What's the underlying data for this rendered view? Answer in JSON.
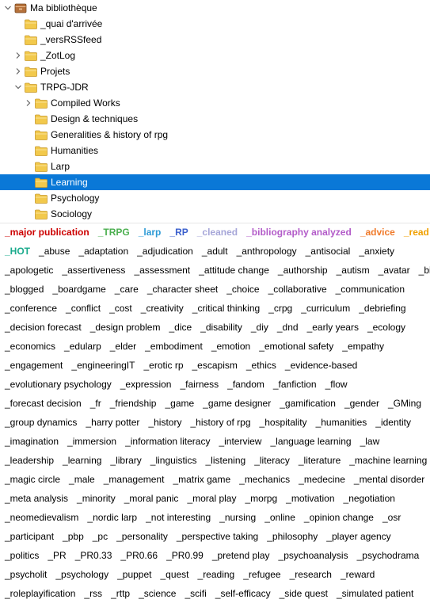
{
  "tree": {
    "root": {
      "label": "Ma bibliothèque",
      "expanded": true
    },
    "items": [
      {
        "label": "_quai d'arrivée",
        "depth": 1,
        "twisty": "none"
      },
      {
        "label": "_versRSSfeed",
        "depth": 1,
        "twisty": "none"
      },
      {
        "label": "_ZotLog",
        "depth": 1,
        "twisty": "collapsed"
      },
      {
        "label": "Projets",
        "depth": 1,
        "twisty": "collapsed"
      },
      {
        "label": "TRPG-JDR",
        "depth": 1,
        "twisty": "expanded"
      },
      {
        "label": "Compiled Works",
        "depth": 2,
        "twisty": "collapsed"
      },
      {
        "label": "Design & techniques",
        "depth": 2,
        "twisty": "none"
      },
      {
        "label": "Generalities & history of rpg",
        "depth": 2,
        "twisty": "none"
      },
      {
        "label": "Humanities",
        "depth": 2,
        "twisty": "none"
      },
      {
        "label": "Larp",
        "depth": 2,
        "twisty": "none"
      },
      {
        "label": "Learning",
        "depth": 2,
        "twisty": "none",
        "selected": true
      },
      {
        "label": "Psychology",
        "depth": 2,
        "twisty": "none"
      },
      {
        "label": "Sociology",
        "depth": 2,
        "twisty": "none"
      }
    ]
  },
  "colors": {
    "selection": "#0a78d7",
    "folder": "#f2c94c",
    "folder_edge": "#c99a2e",
    "library_icon": "#b5713a"
  },
  "tag_lines": [
    [
      {
        "text": "_major publication",
        "color": "#cc0000"
      },
      {
        "text": "_TRPG",
        "color": "#4caf50"
      },
      {
        "text": "_larp",
        "color": "#2e9bd6"
      },
      {
        "text": "_RP",
        "color": "#3a5fcd"
      },
      {
        "text": "_cleaned",
        "color": "#a6a6d8"
      },
      {
        "text": "_bibliography analyzed",
        "color": "#b35cc9"
      },
      {
        "text": "_advice",
        "color": "#f07a2a"
      },
      {
        "text": "_read",
        "color": "#f0a000"
      }
    ],
    [
      {
        "text": "_HOT",
        "color": "#1aaa8c"
      },
      "_abuse",
      "_adaptation",
      "_adjudication",
      "_adult",
      "_anthropology",
      "_antisocial",
      "_anxiety"
    ],
    [
      "_apologetic",
      "_assertiveness",
      "_assessment",
      "_attitude change",
      "_authorship",
      "_autism",
      "_avatar",
      "_bias"
    ],
    [
      "_blogged",
      "_boardgame",
      "_care",
      "_character sheet",
      "_choice",
      "_collaborative",
      "_communication"
    ],
    [
      "_conference",
      "_conflict",
      "_cost",
      "_creativity",
      "_critical thinking",
      "_crpg",
      "_curriculum",
      "_debriefing"
    ],
    [
      "_decision forecast",
      "_design problem",
      "_dice",
      "_disability",
      "_diy",
      "_dnd",
      "_early years",
      "_ecology"
    ],
    [
      "_economics",
      "_edularp",
      "_elder",
      "_embodiment",
      "_emotion",
      "_emotional safety",
      "_empathy"
    ],
    [
      "_engagement",
      "_engineeringIT",
      "_erotic rp",
      "_escapism",
      "_ethics",
      "_evidence-based"
    ],
    [
      "_evolutionary psychology",
      "_expression",
      "_fairness",
      "_fandom",
      "_fanfiction",
      "_flow"
    ],
    [
      "_forecast decision",
      "_fr",
      "_friendship",
      "_game",
      "_game designer",
      "_gamification",
      "_gender",
      "_GMing"
    ],
    [
      "_group dynamics",
      "_harry potter",
      "_history",
      "_history of rpg",
      "_hospitality",
      "_humanities",
      "_identity"
    ],
    [
      "_imagination",
      "_immersion",
      "_information literacy",
      "_interview",
      "_language learning",
      "_law"
    ],
    [
      "_leadership",
      "_learning",
      "_library",
      "_linguistics",
      "_listening",
      "_literacy",
      "_literature",
      "_machine learning"
    ],
    [
      "_magic circle",
      "_male",
      "_management",
      "_matrix game",
      "_mechanics",
      "_medecine",
      "_mental disorder"
    ],
    [
      "_meta analysis",
      "_minority",
      "_moral panic",
      "_moral play",
      "_morpg",
      "_motivation",
      "_negotiation"
    ],
    [
      "_neomedievalism",
      "_nordic larp",
      "_not interesting",
      "_nursing",
      "_online",
      "_opinion change",
      "_osr"
    ],
    [
      "_participant",
      "_pbp",
      "_pc",
      "_personality",
      "_perspective taking",
      "_philosophy",
      "_player agency"
    ],
    [
      "_politics",
      "_PR",
      "_PR0.33",
      "_PR0.66",
      "_PR0.99",
      "_pretend play",
      "_psychoanalysis",
      "_psychodrama"
    ],
    [
      "_psycholit",
      "_psychology",
      "_puppet",
      "_quest",
      "_reading",
      "_refugee",
      "_research",
      "_reward"
    ],
    [
      "_roleplayification",
      "_rss",
      "_rttp",
      "_science",
      "_scifi",
      "_self-efficacy",
      "_side quest",
      "_simulated patient"
    ]
  ]
}
